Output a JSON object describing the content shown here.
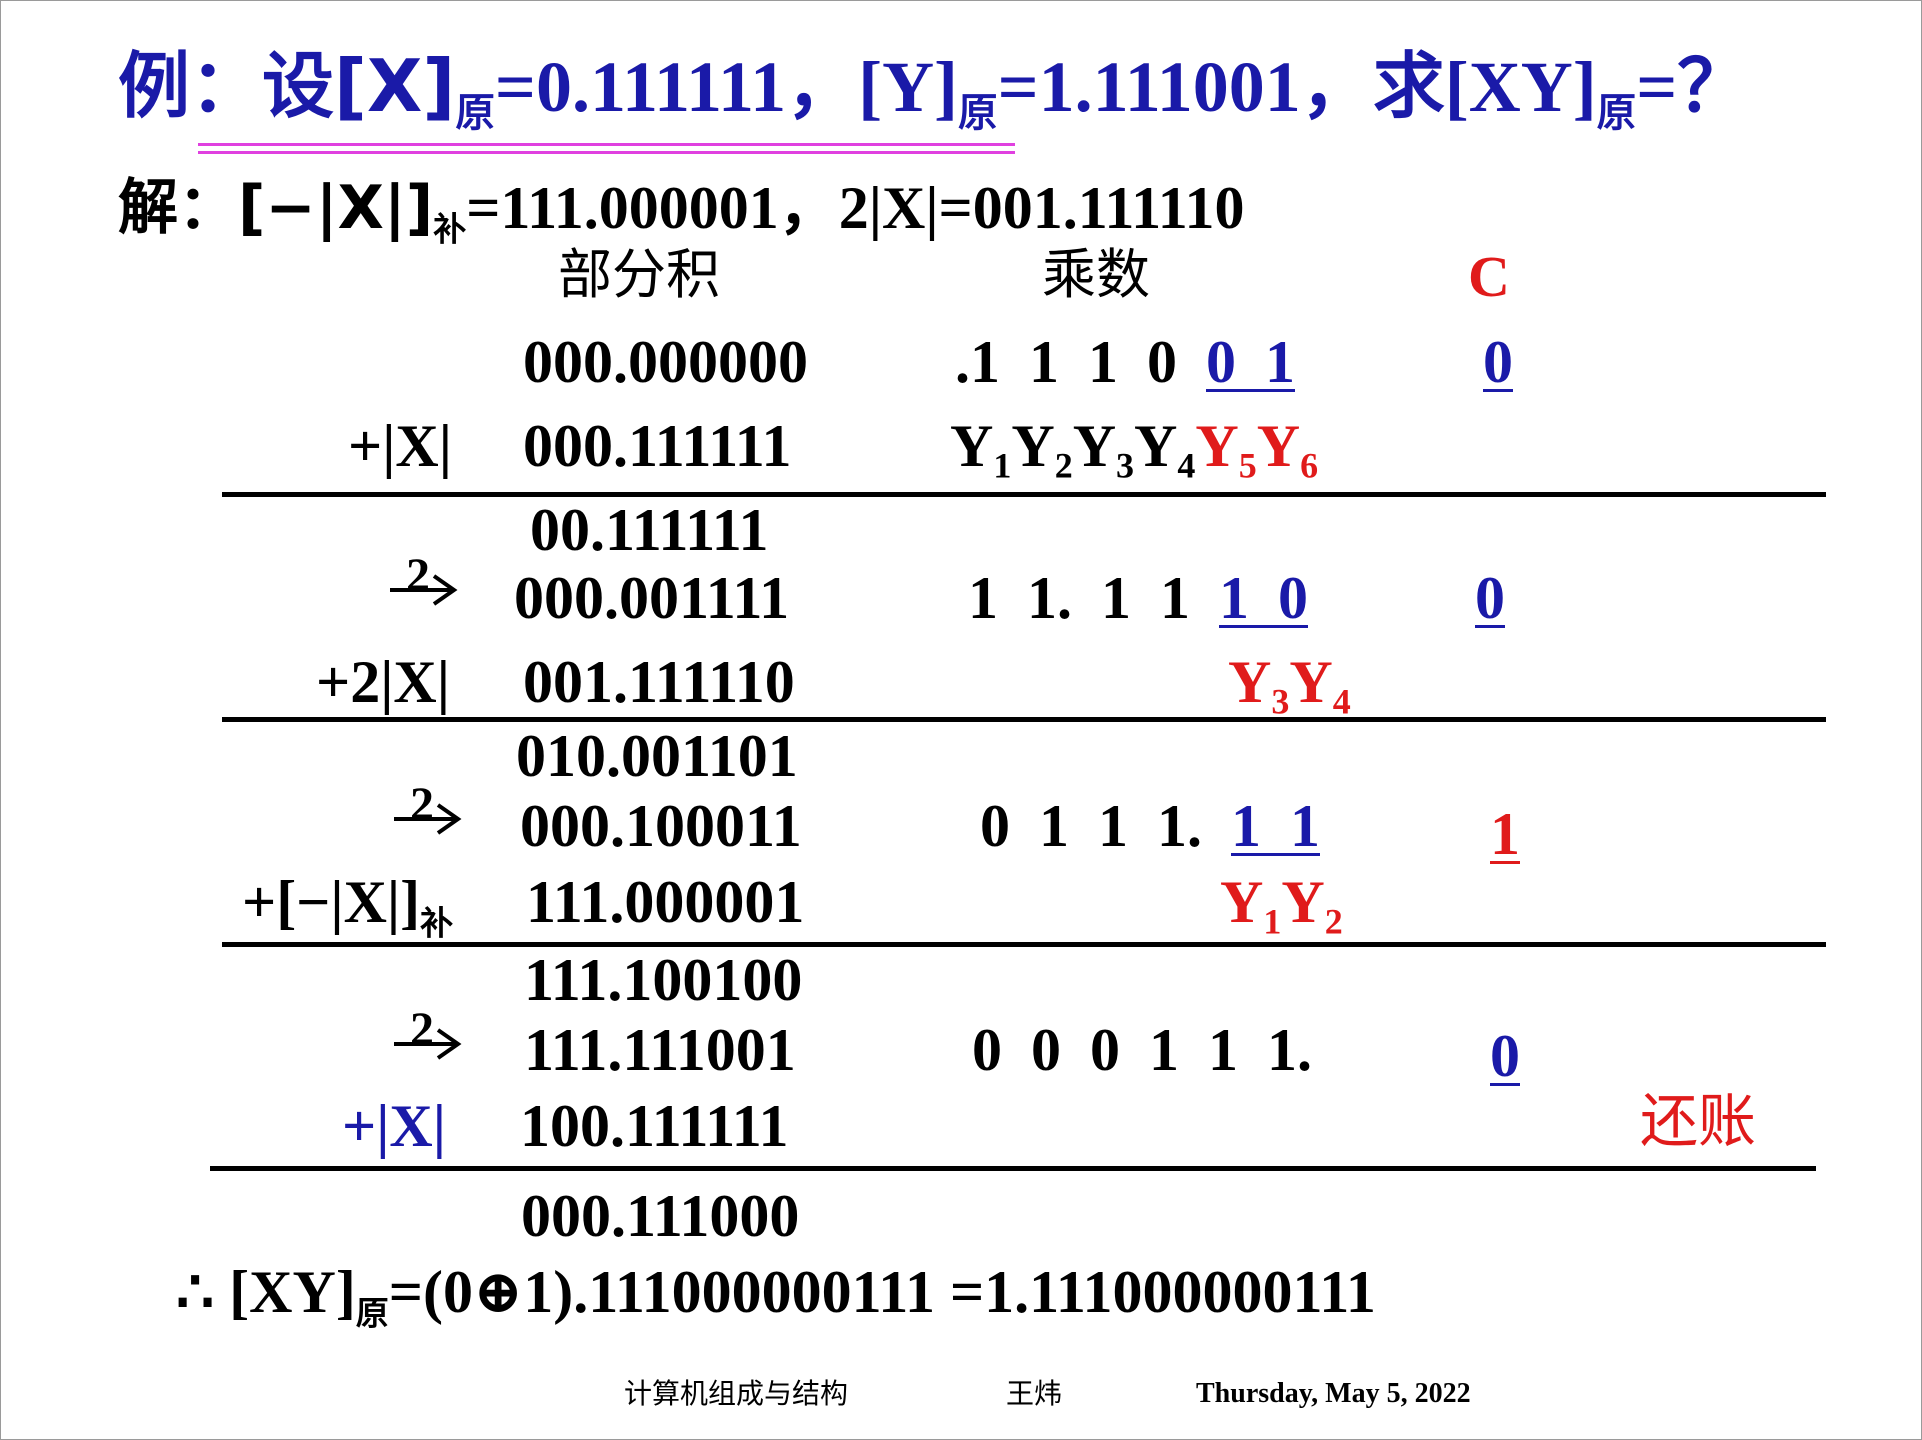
{
  "title": {
    "prefix": "例：设[X]",
    "sub1": "原",
    "eq1": "=0.111111，[Y]",
    "sub2": "原",
    "eq2": "=1.111001，求[XY]",
    "sub3": "原",
    "suffix": "=？"
  },
  "solution": {
    "prefix": "解：[−|X|]",
    "sub": "补",
    "rest": "=111.000001，2|X|=001.111110"
  },
  "headers": {
    "partial": "部分积",
    "multiplier": "乘数",
    "carry": "C"
  },
  "steps": {
    "row0": {
      "partial": "000.000000",
      "mult_plain": ".1 1 1 0 ",
      "mult_under": "0 1",
      "carry": "0"
    },
    "add1": {
      "op": "+|X|",
      "value": "000.111111"
    },
    "ylabels1": {
      "black": [
        "1",
        "2",
        "3",
        "4"
      ],
      "red": [
        "5",
        "6"
      ],
      "letter": "Y"
    },
    "sum1": "00.111111",
    "shift1": {
      "label": "2",
      "value": "000.001111",
      "mult_plain": "1 1. 1 1 ",
      "mult_under": "1 0",
      "carry": "0"
    },
    "add2": {
      "op": "+2|X|",
      "value": "001.111110"
    },
    "ylabels2": {
      "red": [
        "3",
        "4"
      ],
      "letter": "Y"
    },
    "sum2": "010.001101",
    "shift2": {
      "label": "2",
      "value": "000.100011",
      "mult_plain": "0 1 1 1. ",
      "mult_under": "1 1",
      "carry": "1"
    },
    "add3": {
      "op": "+[−|X|]",
      "sub": "补",
      "value": "111.000001"
    },
    "ylabels3": {
      "red": [
        "1",
        "2"
      ],
      "letter": "Y"
    },
    "sum3": "111.100100",
    "shift3": {
      "label": "2",
      "value": "111.111001",
      "mult_plain": "0 0 0 1 1 1.",
      "carry": "0"
    },
    "add4": {
      "op": "+|X|",
      "value": "100.111111",
      "note": "还账"
    },
    "final": "000.111000"
  },
  "conclusion": {
    "prefix": "∴ [XY]",
    "sub": "原",
    "rest": "=(0⊕1).111000000111 =1.111000000111"
  },
  "footer": {
    "course": "计算机组成与结构",
    "author": "王炜",
    "date": "Thursday, May 5, 2022"
  },
  "colors": {
    "title": "#1a1aa8",
    "highlight": "#e01b1b",
    "underline_bar": "#e040e0"
  }
}
